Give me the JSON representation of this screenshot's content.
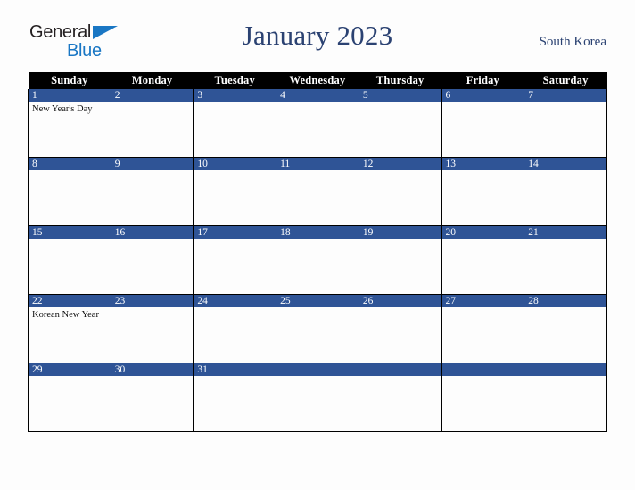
{
  "brand": {
    "line1": "General",
    "line2": "Blue",
    "triangle_color": "#1a77c4",
    "text_color": "#231f20"
  },
  "header": {
    "title": "January 2023",
    "country": "South Korea",
    "title_color": "#2b4272"
  },
  "calendar": {
    "weekday_headers": [
      "Sunday",
      "Monday",
      "Tuesday",
      "Wednesday",
      "Thursday",
      "Friday",
      "Saturday"
    ],
    "header_bg": "#000000",
    "header_text": "#ffffff",
    "daybar_bg": "#2f5496",
    "daybar_text": "#ffffff",
    "cell_bg": "#fdfdfd",
    "weeks": [
      [
        {
          "day": "1",
          "events": [
            "New Year's Day"
          ]
        },
        {
          "day": "2",
          "events": []
        },
        {
          "day": "3",
          "events": []
        },
        {
          "day": "4",
          "events": []
        },
        {
          "day": "5",
          "events": []
        },
        {
          "day": "6",
          "events": []
        },
        {
          "day": "7",
          "events": []
        }
      ],
      [
        {
          "day": "8",
          "events": []
        },
        {
          "day": "9",
          "events": []
        },
        {
          "day": "10",
          "events": []
        },
        {
          "day": "11",
          "events": []
        },
        {
          "day": "12",
          "events": []
        },
        {
          "day": "13",
          "events": []
        },
        {
          "day": "14",
          "events": []
        }
      ],
      [
        {
          "day": "15",
          "events": []
        },
        {
          "day": "16",
          "events": []
        },
        {
          "day": "17",
          "events": []
        },
        {
          "day": "18",
          "events": []
        },
        {
          "day": "19",
          "events": []
        },
        {
          "day": "20",
          "events": []
        },
        {
          "day": "21",
          "events": []
        }
      ],
      [
        {
          "day": "22",
          "events": [
            "Korean New Year"
          ]
        },
        {
          "day": "23",
          "events": []
        },
        {
          "day": "24",
          "events": []
        },
        {
          "day": "25",
          "events": []
        },
        {
          "day": "26",
          "events": []
        },
        {
          "day": "27",
          "events": []
        },
        {
          "day": "28",
          "events": []
        }
      ],
      [
        {
          "day": "29",
          "events": []
        },
        {
          "day": "30",
          "events": []
        },
        {
          "day": "31",
          "events": []
        },
        {
          "day": "",
          "events": []
        },
        {
          "day": "",
          "events": []
        },
        {
          "day": "",
          "events": []
        },
        {
          "day": "",
          "events": []
        }
      ]
    ]
  }
}
